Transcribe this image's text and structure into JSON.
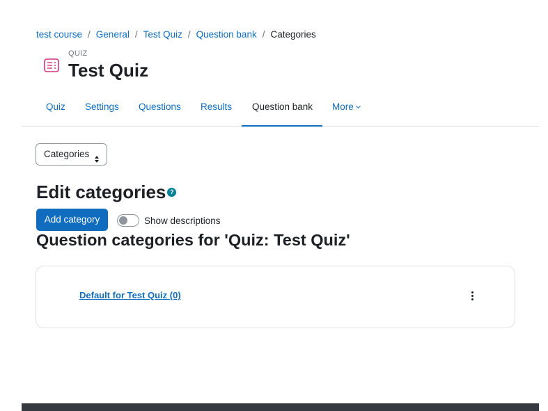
{
  "breadcrumb": {
    "items": [
      "test course",
      "General",
      "Test Quiz",
      "Question bank"
    ],
    "current": "Categories",
    "separator": "/"
  },
  "header": {
    "module_label": "QUIZ",
    "title": "Test Quiz",
    "icon": "quiz-icon"
  },
  "tabs": [
    {
      "label": "Quiz",
      "active": false
    },
    {
      "label": "Settings",
      "active": false
    },
    {
      "label": "Questions",
      "active": false
    },
    {
      "label": "Results",
      "active": false
    },
    {
      "label": "Question bank",
      "active": true
    },
    {
      "label": "More",
      "active": false
    }
  ],
  "selector": {
    "value": "Categories"
  },
  "edit": {
    "heading": "Edit categories",
    "help_icon": "?",
    "add_button": "Add category",
    "toggle_label": "Show descriptions",
    "toggle_on": false
  },
  "categories": {
    "heading": "Question categories for 'Quiz: Test Quiz'",
    "items": [
      {
        "label": "Default for Test Quiz (0)"
      }
    ]
  },
  "colors": {
    "accent": "#0f6cbf",
    "quiz_icon": "#d63384",
    "help": "#008196",
    "footer": "#343a40"
  }
}
